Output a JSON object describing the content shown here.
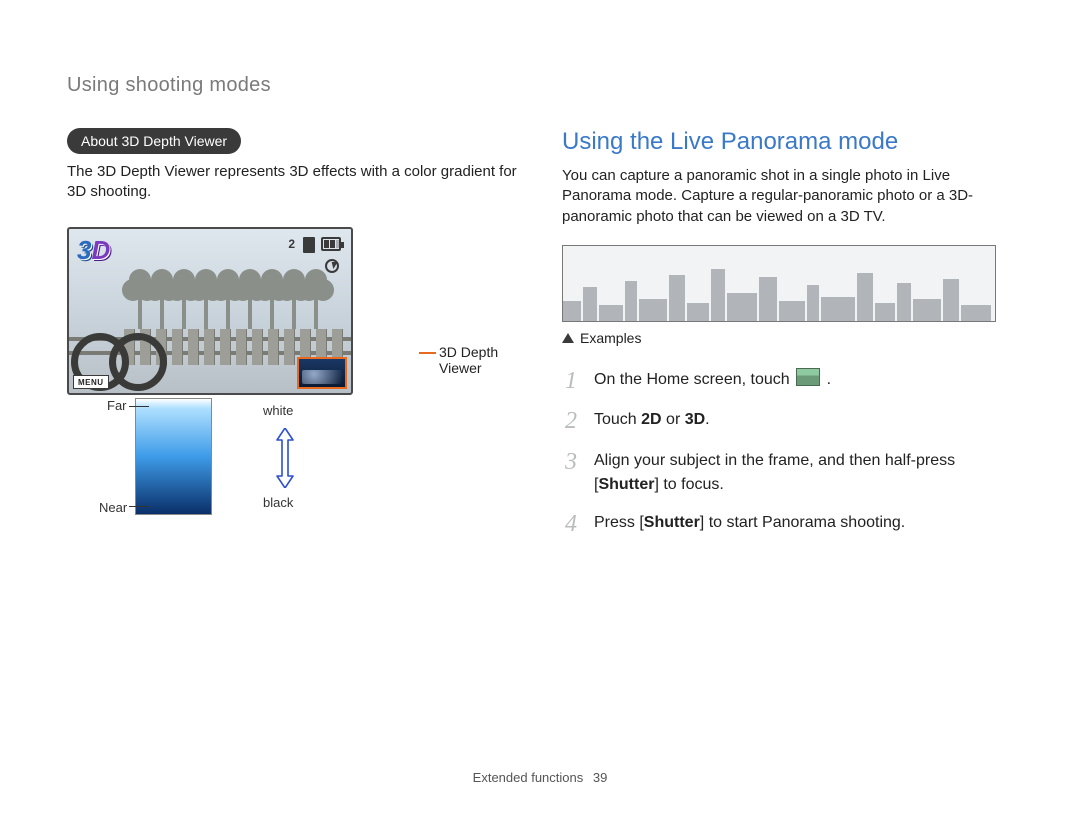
{
  "chapter_title": "Using shooting modes",
  "left": {
    "pill": "About 3D Depth Viewer",
    "intro": "The 3D Depth Viewer represents 3D effects with a color gradient for 3D shooting.",
    "callout_depth_viewer": "3D Depth Viewer",
    "gradient": {
      "far": "Far",
      "near": "Near",
      "white": "white",
      "black": "black"
    },
    "screen": {
      "count": "2",
      "logo_3": "3",
      "logo_D": "D",
      "menu": "MENU"
    }
  },
  "right": {
    "title": "Using the Live Panorama mode",
    "intro": "You can capture a panoramic shot in a single photo in Live Panorama mode. Capture a regular-panoramic photo or a 3D-panoramic photo that can be viewed on a 3D TV.",
    "examples_label": "Examples",
    "steps": {
      "n1": "1",
      "s1_a": "On the Home screen, touch ",
      "s1_b": ".",
      "n2": "2",
      "s2_a": "Touch ",
      "s2_b1": "2D",
      "s2_c": " or ",
      "s2_b2": "3D",
      "s2_d": ".",
      "n3": "3",
      "s3_a": "Align your subject in the frame, and then half-press [",
      "s3_b": "Shutter",
      "s3_c": "] to focus.",
      "n4": "4",
      "s4_a": "Press [",
      "s4_b": "Shutter",
      "s4_c": "] to start Panorama shooting."
    }
  },
  "footer": {
    "section": "Extended functions",
    "page": "39"
  }
}
